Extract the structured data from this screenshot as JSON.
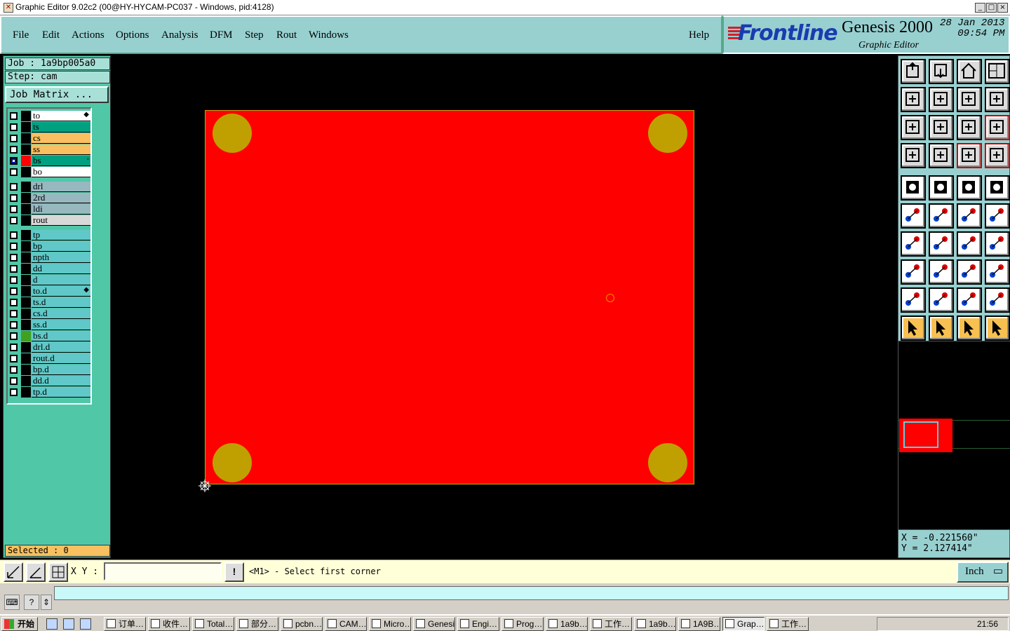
{
  "window": {
    "title": "Graphic Editor 9.02c2 (00@HY-HYCAM-PC037 - Windows, pid:4128)"
  },
  "menu": {
    "items": [
      "File",
      "Edit",
      "Actions",
      "Options",
      "Analysis",
      "DFM",
      "Step",
      "Rout",
      "Windows"
    ],
    "help": "Help"
  },
  "brand": {
    "logo": "Frontline",
    "product": "Genesis 2000",
    "subtitle": "Graphic Editor",
    "date": "28 Jan 2013",
    "time": "09:54 PM"
  },
  "job": {
    "job_line": "Job : 1a9bp005a0",
    "step_line": "Step: cam",
    "matrix_button": "Job Matrix ..."
  },
  "layers": [
    {
      "name": "to",
      "bg": "#ffffff",
      "mark": "◆"
    },
    {
      "name": "ts",
      "bg": "#00a080",
      "mark": ""
    },
    {
      "name": "cs",
      "bg": "#f8c060",
      "mark": ""
    },
    {
      "name": "ss",
      "bg": "#f8c060",
      "mark": ""
    },
    {
      "name": "bs",
      "bg": "#00a080",
      "mark": "▫",
      "work": true
    },
    {
      "name": "bo",
      "bg": "#ffffff",
      "mark": ""
    },
    {
      "name": "drl",
      "bg": "#98b8c0",
      "mark": ""
    },
    {
      "name": "2rd",
      "bg": "#98b8c0",
      "mark": ""
    },
    {
      "name": "ldi",
      "bg": "#98b8c0",
      "mark": ""
    },
    {
      "name": "rout",
      "bg": "#d8d8d8",
      "mark": ""
    },
    {
      "name": "tp",
      "bg": "#60c8c8",
      "mark": ""
    },
    {
      "name": "bp",
      "bg": "#60c8c8",
      "mark": ""
    },
    {
      "name": "npth",
      "bg": "#60c8c8",
      "mark": ""
    },
    {
      "name": "dd",
      "bg": "#60c8c8",
      "mark": ""
    },
    {
      "name": "d",
      "bg": "#60c8c8",
      "mark": ""
    },
    {
      "name": "to.d",
      "bg": "#60c8c8",
      "mark": "◆"
    },
    {
      "name": "ts.d",
      "bg": "#60c8c8",
      "mark": ""
    },
    {
      "name": "cs.d",
      "bg": "#60c8c8",
      "mark": ""
    },
    {
      "name": "ss.d",
      "bg": "#60c8c8",
      "mark": ""
    },
    {
      "name": "bs.d",
      "bg": "#60c8c8",
      "mark": "",
      "green": true
    },
    {
      "name": "drl.d",
      "bg": "#60c8c8",
      "mark": ""
    },
    {
      "name": "rout.d",
      "bg": "#60c8c8",
      "mark": ""
    },
    {
      "name": "bp.d",
      "bg": "#60c8c8",
      "mark": ""
    },
    {
      "name": "dd.d",
      "bg": "#60c8c8",
      "mark": ""
    },
    {
      "name": "tp.d",
      "bg": "#60c8c8",
      "mark": ""
    }
  ],
  "selected": "Selected : 0",
  "coords": {
    "x": "X = -0.221560\"",
    "y": "Y = 2.127414\""
  },
  "command": {
    "xy_label": "X Y :",
    "xy_value": "",
    "prompt": "<M1> - Select first corner",
    "unit": "Inch"
  },
  "toolbar_icons": [
    "open-icon",
    "save-icon",
    "home-icon",
    "window-icon",
    "prev-icon",
    "next-icon",
    "undo-icon",
    "redraw-icon",
    "zoom-fit-icon",
    "zoom-center-icon",
    "one-to-one-icon",
    "help-icon",
    "snap-icon",
    "measure-icon",
    "layers-icon",
    "layers-red-icon",
    "pad-icon",
    "line-icon",
    "ruler-icon",
    "circle-icon",
    "connect-icon",
    "cross-icon",
    "move-icon",
    "copy-icon",
    "angle-icon",
    "slope-icon",
    "arc-icon",
    "mirror-icon",
    "resize-icon",
    "split-icon",
    "scale-icon",
    "group-icon",
    "triangle-icon",
    "polygon-icon",
    "arc-poly-icon",
    "net-icon",
    "select-icon",
    "select-box-icon",
    "select-area-icon",
    "select-poly-icon"
  ],
  "taskbar": {
    "start": "开始",
    "tasks": [
      "订单…",
      "收件…",
      "Total…",
      "部分…",
      "pcbn…",
      "CAM…",
      "Micro…",
      "Genesis",
      "Engi…",
      "Prog…",
      "1a9b…",
      "工作…",
      "1a9b…",
      "1A9B…",
      "Grap…",
      "工作…"
    ],
    "clock": "21:56"
  },
  "colors": {
    "board": "#ff0000",
    "hole": "#c0a000",
    "panel": "#50c8a8",
    "accent": "#98d0d0"
  }
}
